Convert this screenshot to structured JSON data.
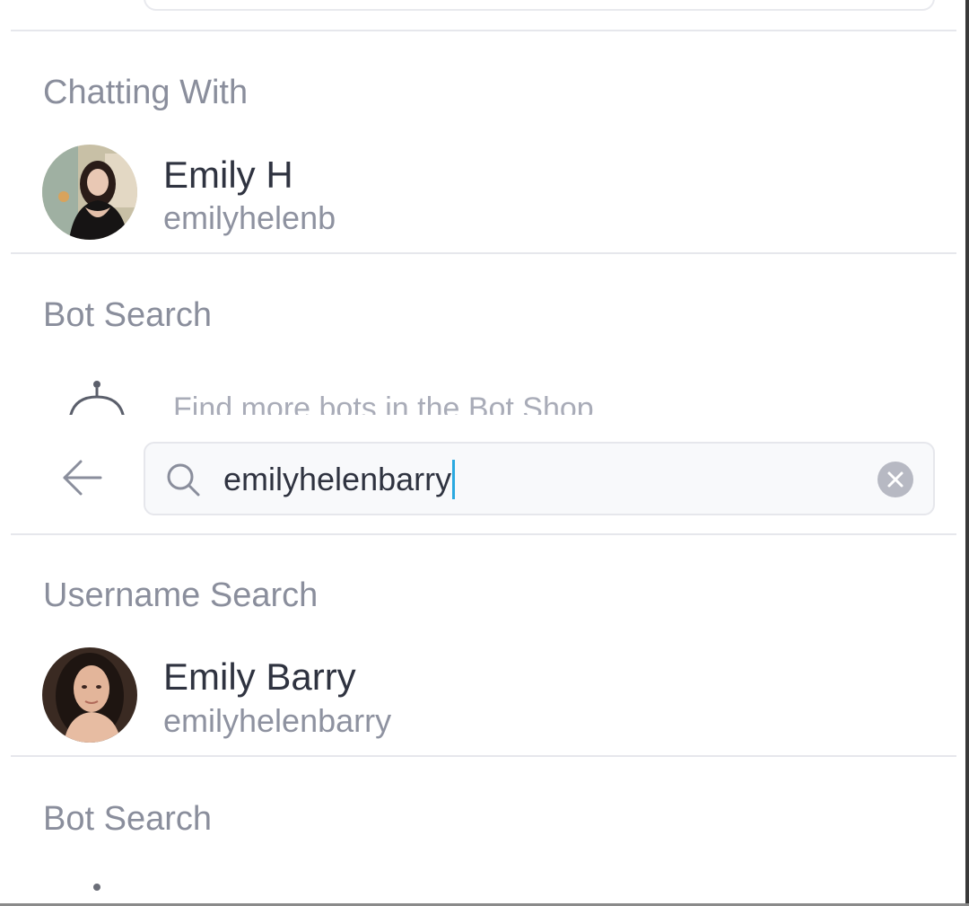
{
  "sections": {
    "chatting_with": {
      "title": "Chatting With",
      "contact": {
        "name": "Emily H",
        "username": "emilyhelenb"
      }
    },
    "bot_search_top": {
      "title": "Bot Search",
      "item_text": "Find more bots in the Bot Shop"
    },
    "search": {
      "value": "emilyhelenbarry",
      "back_icon": "arrow-left-icon",
      "search_icon": "magnifier-icon",
      "clear_icon": "clear-x-icon"
    },
    "username_search": {
      "title": "Username Search",
      "result": {
        "name": "Emily Barry",
        "username": "emilyhelenbarry"
      }
    },
    "bot_search_bottom": {
      "title": "Bot Search"
    }
  },
  "colors": {
    "accent_caret": "#2aa9e0",
    "section_title": "#8a8e9c",
    "divider": "#e6e7ec"
  }
}
